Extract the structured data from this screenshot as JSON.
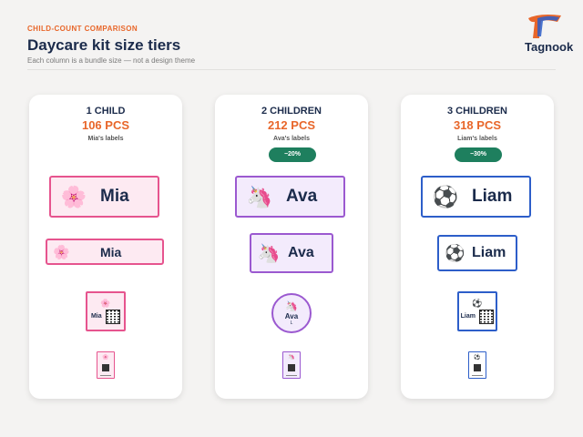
{
  "header": {
    "eyebrow": "CHILD-COUNT COMPARISON",
    "title": "Daycare kit size tiers",
    "subtitle": "Each column is a bundle size — not a design theme"
  },
  "brand": {
    "name": "Tagnook",
    "accent": "#e8662a",
    "navy": "#1b2b4b"
  },
  "columns": [
    {
      "name": "1 CHILD",
      "count": "106 PCS",
      "owner": "Mia's labels",
      "badge": "",
      "child": "Mia",
      "icon": "cherry-blossom-icon",
      "glyph": "🌸",
      "color": "#e6548e"
    },
    {
      "name": "2 CHILDREN",
      "count": "212 PCS",
      "owner": "Ava's labels",
      "badge": "−20%",
      "child": "Ava",
      "icon": "unicorn-icon",
      "glyph": "🦄",
      "size_mark": "L",
      "color": "#9b59d0"
    },
    {
      "name": "3 CHILDREN",
      "count": "318 PCS",
      "owner": "Liam's labels",
      "badge": "−30%",
      "child": "Liam",
      "icon": "soccer-ball-icon",
      "glyph": "⚽",
      "color": "#2d5ec9"
    }
  ]
}
